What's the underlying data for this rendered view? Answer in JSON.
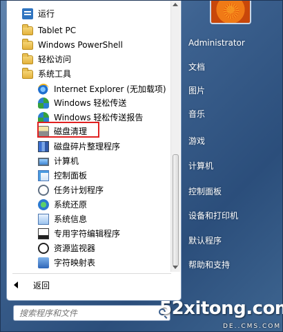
{
  "list": {
    "items": [
      {
        "label": "运行",
        "icon": "run-icon",
        "level": 1,
        "kind": "run"
      },
      {
        "label": "Tablet PC",
        "icon": "folder-icon",
        "level": 1,
        "kind": "folder"
      },
      {
        "label": "Windows PowerShell",
        "icon": "folder-icon",
        "level": 1,
        "kind": "folder"
      },
      {
        "label": "轻松访问",
        "icon": "folder-icon",
        "level": 1,
        "kind": "folder"
      },
      {
        "label": "系统工具",
        "icon": "folder-icon",
        "level": 1,
        "kind": "folder"
      },
      {
        "label": "Internet Explorer (无加载项)",
        "icon": "internet-explorer-icon",
        "level": 2,
        "kind": "ie"
      },
      {
        "label": "Windows 轻松传送",
        "icon": "easy-transfer-icon",
        "level": 2,
        "kind": "transfer"
      },
      {
        "label": "Windows 轻松传送报告",
        "icon": "easy-transfer-report-icon",
        "level": 2,
        "kind": "transfer"
      },
      {
        "label": "磁盘清理",
        "icon": "disk-cleanup-icon",
        "level": 2,
        "kind": "disk",
        "highlighted": true
      },
      {
        "label": "磁盘碎片整理程序",
        "icon": "disk-defragmenter-icon",
        "level": 2,
        "kind": "defrag"
      },
      {
        "label": "计算机",
        "icon": "computer-icon",
        "level": 2,
        "kind": "computer"
      },
      {
        "label": "控制面板",
        "icon": "control-panel-icon",
        "level": 2,
        "kind": "panel"
      },
      {
        "label": "任务计划程序",
        "icon": "task-scheduler-icon",
        "level": 2,
        "kind": "clock"
      },
      {
        "label": "系统还原",
        "icon": "system-restore-icon",
        "level": 2,
        "kind": "restore"
      },
      {
        "label": "系统信息",
        "icon": "system-info-icon",
        "level": 2,
        "kind": "info"
      },
      {
        "label": "专用字符编辑程序",
        "icon": "private-character-editor-icon",
        "level": 2,
        "kind": "editor"
      },
      {
        "label": "资源监视器",
        "icon": "resource-monitor-icon",
        "level": 2,
        "kind": "monitor"
      },
      {
        "label": "字符映射表",
        "icon": "character-map-icon",
        "level": 2,
        "kind": "charmap"
      }
    ]
  },
  "back_label": "返回",
  "search": {
    "placeholder": "搜索程序和文件"
  },
  "right": {
    "items": [
      "Administrator",
      "文档",
      "图片",
      "音乐",
      "游戏",
      "计算机",
      "控制面板",
      "设备和打印机",
      "默认程序",
      "帮助和支持"
    ]
  },
  "watermark": {
    "main": "52xitong.com",
    "sub": "DE..CMS.COM"
  },
  "colors": {
    "highlight_border": "#e02020",
    "menu_background": "#3d6290"
  }
}
